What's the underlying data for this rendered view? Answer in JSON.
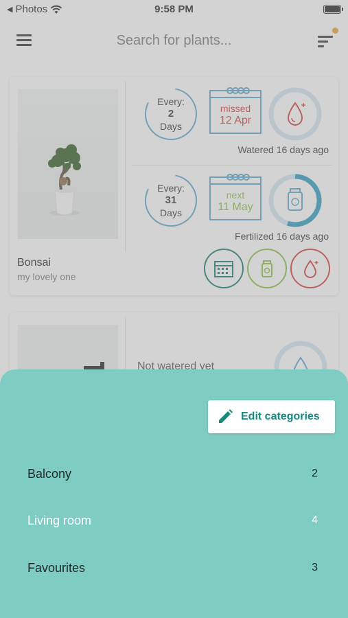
{
  "status_bar": {
    "back_label": "Photos",
    "time": "9:58 PM"
  },
  "app_bar": {
    "search_placeholder": "Search for plants..."
  },
  "plants": [
    {
      "name": "Bonsai",
      "description": "my lovely one",
      "watering": {
        "every_label": "Every:",
        "interval": "2",
        "unit": "Days",
        "date_state": "missed",
        "date": "12 Apr",
        "status": "Watered 16 days ago"
      },
      "fertilizing": {
        "every_label": "Every:",
        "interval": "31",
        "unit": "Days",
        "date_state": "next",
        "date": "11 May",
        "status": "Fertilized 16 days ago",
        "progress": 0.55
      }
    },
    {
      "status": "Not watered yet"
    }
  ],
  "sheet": {
    "edit_label": "Edit categories",
    "categories": [
      {
        "name": "Balcony",
        "count": "2"
      },
      {
        "name": "Living room",
        "count": "4"
      },
      {
        "name": "Favourites",
        "count": "3"
      }
    ]
  },
  "colors": {
    "sheet_bg": "#7fccc3",
    "accent": "#14897c",
    "missed": "#d23f3a",
    "next": "#8bbf43",
    "ring": "#5aa6cc",
    "notification_dot": "#e8a53a"
  }
}
